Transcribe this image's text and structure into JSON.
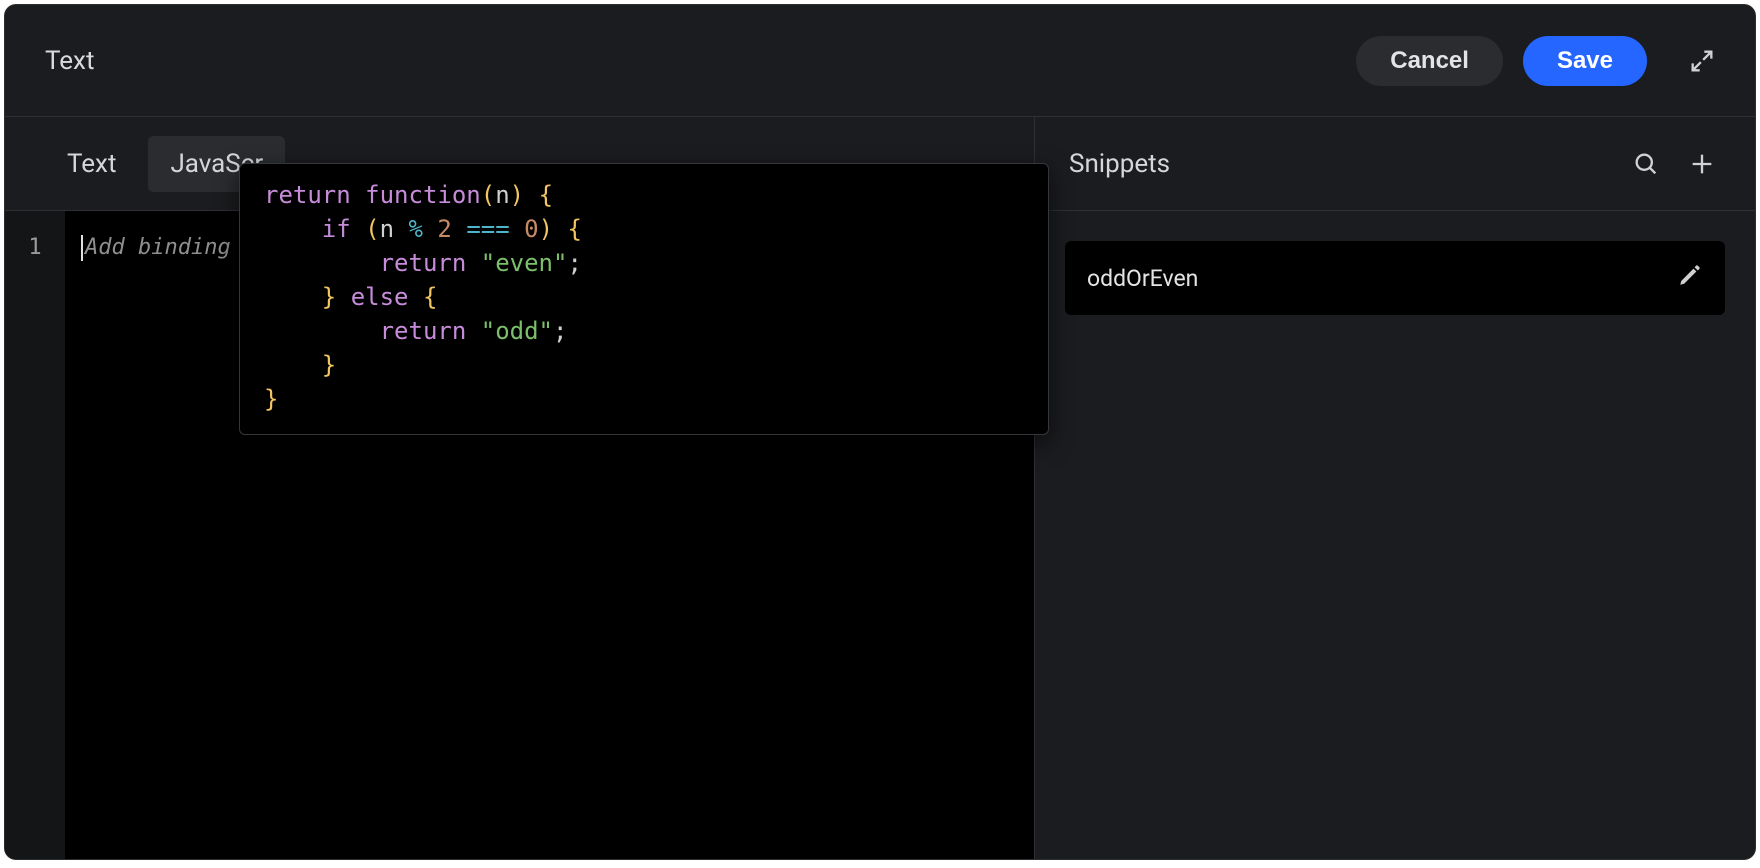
{
  "header": {
    "title": "Text",
    "cancel_label": "Cancel",
    "save_label": "Save"
  },
  "tabs": {
    "text_label": "Text",
    "js_label_visible": "JavaScr"
  },
  "editor": {
    "line_number": "1",
    "placeholder_visible": "Add binding"
  },
  "popover": {
    "tokens": {
      "kw_return": "return",
      "kw_function": "function",
      "kw_if": "if",
      "kw_else": "else",
      "id_n": "n",
      "num_2": "2",
      "num_0": "0",
      "op_mod": "%",
      "op_eqeqeq": "===",
      "str_even": "\"even\"",
      "str_odd": "\"odd\""
    }
  },
  "right": {
    "title": "Snippets"
  },
  "snippets": [
    {
      "name": "oddOrEven"
    }
  ]
}
